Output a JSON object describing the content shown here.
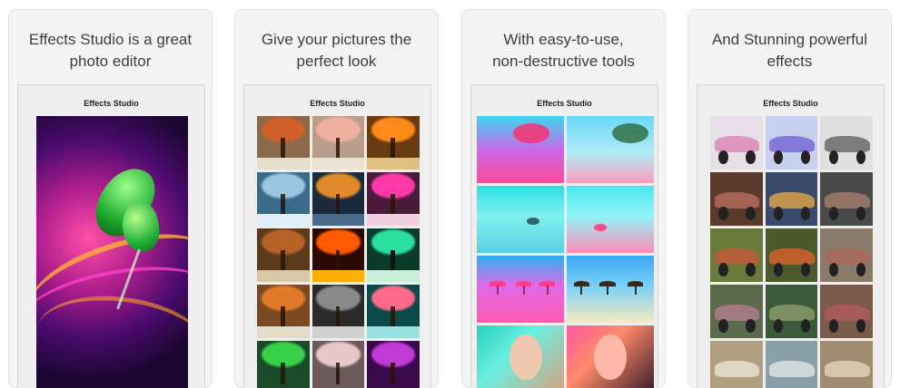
{
  "panels": [
    {
      "caption": [
        "Effects Studio is a great",
        "photo editor"
      ],
      "app_title": "Effects Studio"
    },
    {
      "caption": [
        "Give your pictures the",
        "perfect look"
      ],
      "app_title": "Effects Studio"
    },
    {
      "caption": [
        "With easy-to-use,",
        "non-destructive tools"
      ],
      "app_title": "Effects Studio"
    },
    {
      "caption": [
        "And Stunning powerful",
        "effects"
      ],
      "app_title": "Effects Studio"
    }
  ],
  "colors": {
    "card_bg": "#f4f4f4",
    "caption_text": "#3d3d3d"
  }
}
